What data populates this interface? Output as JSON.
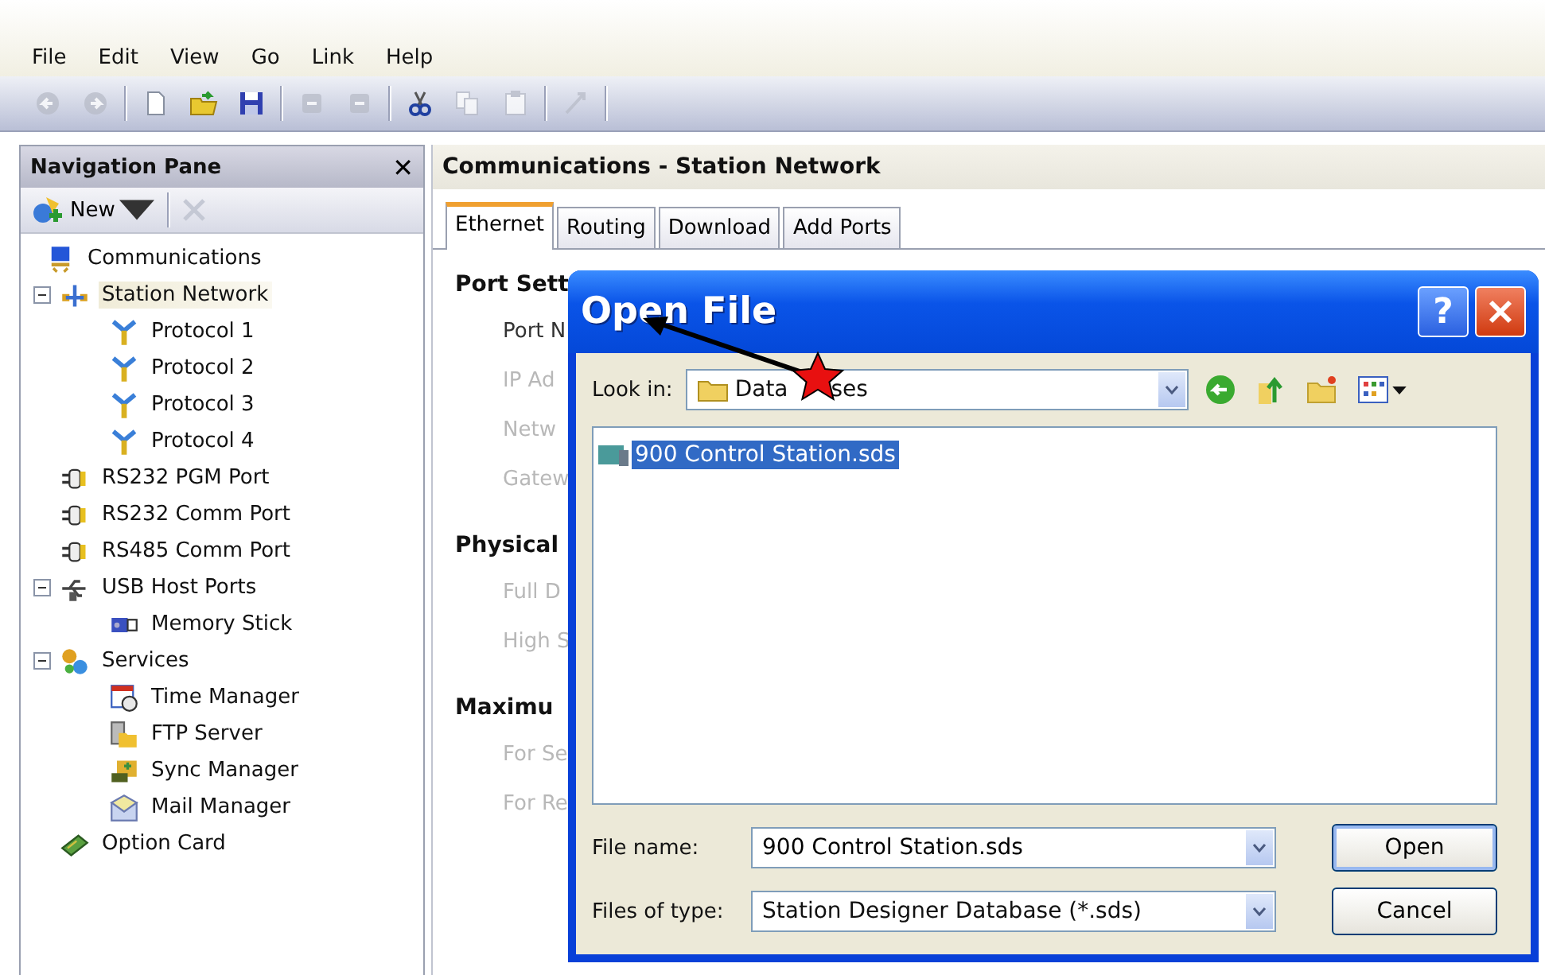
{
  "menu": [
    "File",
    "Edit",
    "View",
    "Go",
    "Link",
    "Help"
  ],
  "toolbar": [
    {
      "kind": "button",
      "disabled": true
    },
    {
      "kind": "button",
      "disabled": true
    },
    {
      "kind": "separator"
    },
    {
      "kind": "button",
      "disabled": false
    },
    {
      "kind": "button",
      "disabled": false
    },
    {
      "kind": "button",
      "disabled": false
    },
    {
      "kind": "separator"
    },
    {
      "kind": "button",
      "disabled": true
    },
    {
      "kind": "button",
      "disabled": true
    },
    {
      "kind": "separator"
    },
    {
      "kind": "button",
      "disabled": false
    },
    {
      "kind": "button",
      "disabled": true
    },
    {
      "kind": "button",
      "disabled": true
    },
    {
      "kind": "separator"
    },
    {
      "kind": "button",
      "disabled": true
    },
    {
      "kind": "separator"
    }
  ],
  "navigation_pane": {
    "title": "Navigation Pane",
    "close": "✕",
    "new_button": "New",
    "tree": [
      {
        "label": "Communications",
        "selected": false,
        "children": [
          {
            "label": "Station Network",
            "selected": true,
            "expanded": true,
            "children": [
              {
                "label": "Protocol 1",
                "selected": false
              },
              {
                "label": "Protocol 2",
                "selected": false
              },
              {
                "label": "Protocol 3",
                "selected": false
              },
              {
                "label": "Protocol 4",
                "selected": false
              }
            ]
          },
          {
            "label": "RS232 PGM Port",
            "selected": false
          },
          {
            "label": "RS232 Comm Port",
            "selected": false
          },
          {
            "label": "RS485 Comm Port",
            "selected": false
          },
          {
            "label": "USB Host Ports",
            "selected": false,
            "expanded": true,
            "children": [
              {
                "label": "Memory Stick",
                "selected": false
              }
            ]
          },
          {
            "label": "Services",
            "selected": false,
            "expanded": true,
            "children": [
              {
                "label": "Time Manager",
                "selected": false
              },
              {
                "label": "FTP Server",
                "selected": false
              },
              {
                "label": "Sync Manager",
                "selected": false
              },
              {
                "label": "Mail Manager",
                "selected": false
              }
            ]
          },
          {
            "label": "Option Card",
            "selected": false
          }
        ]
      }
    ]
  },
  "content": {
    "title": "Communications - Station Network",
    "tabs": [
      {
        "label": "Ethernet",
        "selected": true
      },
      {
        "label": "Routing",
        "selected": false
      },
      {
        "label": "Download",
        "selected": false
      },
      {
        "label": "Add Ports",
        "selected": false
      }
    ],
    "sections": [
      {
        "heading": "Port Sett",
        "fields": [
          "Port N",
          "IP Ad",
          "Netw",
          "Gatew"
        ]
      },
      {
        "heading": "Physical",
        "fields": [
          "Full D",
          "High S"
        ]
      },
      {
        "heading": "Maximu",
        "fields": [
          "For Se",
          "For Re"
        ]
      }
    ]
  },
  "dialog": {
    "title": "Open File",
    "help": "?",
    "look_in_label": "Look in:",
    "look_in": "Data",
    "look_in_tail": "ses",
    "files": [
      {
        "name": "900 Control Station.sds",
        "selected": true
      }
    ],
    "file_name_label": "File name:",
    "file_name": "900 Control Station.sds",
    "file_type_label": "Files of type:",
    "file_type": "Station Designer Database (*.sds)",
    "buttons": [
      "Open",
      "Cancel"
    ]
  }
}
